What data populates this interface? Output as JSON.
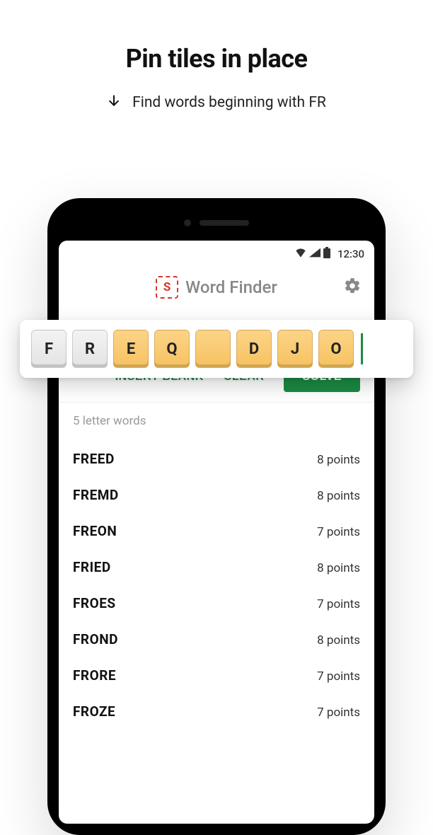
{
  "headline": "Pin tiles in place",
  "subhead": "Find words beginning with FR",
  "status": {
    "time": "12:30"
  },
  "app": {
    "logo_letter": "S",
    "title": "Word Finder"
  },
  "tray": {
    "tiles": [
      {
        "letter": "F",
        "state": "pinned"
      },
      {
        "letter": "R",
        "state": "pinned"
      },
      {
        "letter": "E",
        "state": "normal"
      },
      {
        "letter": "Q",
        "state": "normal"
      },
      {
        "letter": "",
        "state": "blank"
      },
      {
        "letter": "D",
        "state": "normal"
      },
      {
        "letter": "J",
        "state": "normal"
      },
      {
        "letter": "O",
        "state": "normal"
      }
    ]
  },
  "actions": {
    "insert_blank": "INSERT BLANK",
    "clear": "CLEAR",
    "solve": "SOLVE"
  },
  "results": {
    "section_label": "5 letter words",
    "rows": [
      {
        "word": "FREED",
        "points": "8 points"
      },
      {
        "word": "FREMD",
        "points": "8 points"
      },
      {
        "word": "FREON",
        "points": "7 points"
      },
      {
        "word": "FRIED",
        "points": "8 points"
      },
      {
        "word": "FROES",
        "points": "7 points"
      },
      {
        "word": "FROND",
        "points": "8 points"
      },
      {
        "word": "FRORE",
        "points": "7 points"
      },
      {
        "word": "FROZE",
        "points": "7 points"
      }
    ]
  }
}
